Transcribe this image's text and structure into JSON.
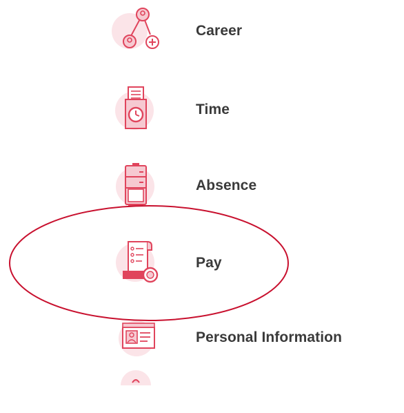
{
  "menu": {
    "items": [
      {
        "label": "Career",
        "icon": "career-icon"
      },
      {
        "label": "Time",
        "icon": "time-icon"
      },
      {
        "label": "Absence",
        "icon": "absence-icon"
      },
      {
        "label": "Pay",
        "icon": "pay-icon"
      },
      {
        "label": "Personal Information",
        "icon": "personal-information-icon"
      }
    ],
    "highlighted": "Pay"
  },
  "colors": {
    "icon_primary": "#e0445c",
    "icon_fill": "#f6c9d1",
    "icon_bg": "#fbe4e8",
    "label": "#3a3a3a",
    "highlight_ring": "#c8102e"
  }
}
